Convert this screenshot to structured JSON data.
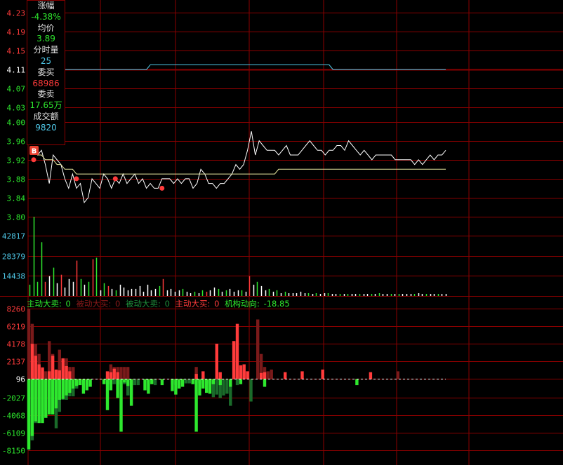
{
  "info_panel": {
    "change_pct_label": "涨幅",
    "change_pct_value": "-4.38%",
    "avg_price_label": "均价",
    "avg_price_value": "3.89",
    "volume_label": "分时量",
    "volume_value": "25",
    "bid_label": "委买",
    "bid_value": "68986",
    "ask_label": "委卖",
    "ask_value": "17.65万",
    "turnover_label": "成交额",
    "turnover_value": "9820"
  },
  "flow_bar": {
    "items": [
      {
        "label": "主动大卖:",
        "value": "0",
        "color": "#2ee82e"
      },
      {
        "label": "被动大买:",
        "value": "0",
        "color": "#8b1a1a"
      },
      {
        "label": "被动大卖:",
        "value": "0",
        "color": "#1e8c3a"
      },
      {
        "label": "主动大买:",
        "value": "0",
        "color": "#ff3b3b"
      }
    ],
    "institution_label": "机构动向:",
    "institution_value": "-18.85"
  },
  "colors": {
    "background": "#000000",
    "grid": "#8b0000",
    "up": "#ff3b3b",
    "down": "#2ee82e",
    "dark_up": "#7a1a1a",
    "dark_down": "#1a6b2a",
    "neutral": "#ffffff",
    "avg_line": "#e8e8a0",
    "index_line": "#4fc8e8"
  },
  "chart_data": [
    {
      "type": "line",
      "name": "price",
      "yticks": [
        "4.23",
        "4.19",
        "4.15",
        "4.11",
        "4.07",
        "4.03",
        "4.00",
        "3.96",
        "3.92",
        "3.88",
        "3.84",
        "3.80"
      ],
      "tick_values": [
        4.23,
        4.19,
        4.15,
        4.11,
        4.07,
        4.03,
        4.0,
        3.96,
        3.92,
        3.88,
        3.84,
        3.8
      ],
      "prev_close": 4.11,
      "ylim": [
        3.8,
        4.23
      ],
      "series": [
        {
          "key": "price",
          "values": [
            3.94,
            3.93,
            3.94,
            3.91,
            3.87,
            3.93,
            3.92,
            3.91,
            3.88,
            3.86,
            3.89,
            3.86,
            3.87,
            3.83,
            3.84,
            3.88,
            3.87,
            3.86,
            3.89,
            3.88,
            3.86,
            3.88,
            3.87,
            3.89,
            3.87,
            3.88,
            3.89,
            3.87,
            3.88,
            3.86,
            3.87,
            3.86,
            3.86,
            3.88,
            3.88,
            3.88,
            3.87,
            3.88,
            3.87,
            3.88,
            3.88,
            3.86,
            3.87,
            3.9,
            3.89,
            3.87,
            3.87,
            3.86,
            3.87,
            3.87,
            3.88,
            3.89,
            3.91,
            3.9,
            3.91,
            3.94,
            3.98,
            3.93,
            3.96,
            3.95,
            3.94,
            3.94,
            3.94,
            3.93,
            3.94,
            3.95,
            3.93,
            3.93,
            3.93,
            3.94,
            3.95,
            3.96,
            3.95,
            3.94,
            3.94,
            3.93,
            3.94,
            3.94,
            3.95,
            3.95,
            3.94,
            3.96,
            3.95,
            3.94,
            3.93,
            3.94,
            3.93,
            3.92,
            3.93,
            3.93,
            3.93,
            3.93,
            3.93,
            3.92,
            3.92,
            3.92,
            3.92,
            3.92,
            3.91,
            3.92,
            3.91,
            3.92,
            3.93,
            3.92,
            3.93,
            3.93,
            3.94
          ]
        },
        {
          "key": "avg",
          "values": [
            3.94,
            3.93,
            3.93,
            3.92,
            3.92,
            3.92,
            3.91,
            3.91,
            3.9,
            3.9,
            3.9,
            3.89,
            3.89,
            3.89,
            3.89,
            3.89,
            3.89,
            3.89,
            3.89,
            3.89,
            3.89,
            3.89,
            3.89,
            3.89,
            3.89,
            3.89,
            3.89,
            3.89,
            3.89,
            3.89,
            3.89,
            3.89,
            3.89,
            3.89,
            3.89,
            3.89,
            3.89,
            3.89,
            3.89,
            3.89,
            3.89,
            3.89,
            3.89,
            3.89,
            3.89,
            3.89,
            3.89,
            3.89,
            3.89,
            3.89,
            3.89,
            3.89,
            3.89,
            3.89,
            3.89,
            3.89,
            3.89,
            3.89,
            3.89,
            3.89,
            3.89,
            3.89,
            3.89,
            3.9,
            3.9,
            3.9,
            3.9,
            3.9,
            3.9,
            3.9,
            3.9,
            3.9,
            3.9,
            3.9,
            3.9,
            3.9,
            3.9,
            3.9,
            3.9,
            3.9,
            3.9,
            3.9,
            3.9,
            3.9,
            3.9,
            3.9,
            3.9,
            3.9,
            3.9,
            3.9,
            3.9,
            3.9,
            3.9,
            3.9,
            3.9,
            3.9,
            3.9,
            3.9,
            3.9,
            3.9,
            3.9,
            3.9,
            3.9,
            3.9,
            3.9,
            3.9,
            3.9
          ]
        },
        {
          "key": "index",
          "values": [
            4.11,
            4.11,
            4.11,
            4.11,
            4.11,
            4.11,
            4.11,
            4.11,
            4.11,
            4.11,
            4.11,
            4.11,
            4.11,
            4.11,
            4.11,
            4.11,
            4.11,
            4.11,
            4.11,
            4.11,
            4.11,
            4.11,
            4.11,
            4.11,
            4.11,
            4.11,
            4.11,
            4.11,
            4.11,
            4.11,
            4.12,
            4.12,
            4.12,
            4.12,
            4.12,
            4.12,
            4.12,
            4.12,
            4.12,
            4.12,
            4.12,
            4.12,
            4.12,
            4.12,
            4.12,
            4.12,
            4.12,
            4.12,
            4.12,
            4.12,
            4.12,
            4.12,
            4.12,
            4.12,
            4.12,
            4.12,
            4.12,
            4.12,
            4.12,
            4.12,
            4.12,
            4.12,
            4.12,
            4.12,
            4.12,
            4.12,
            4.12,
            4.12,
            4.12,
            4.12,
            4.12,
            4.12,
            4.12,
            4.12,
            4.12,
            4.12,
            4.12,
            4.11,
            4.11,
            4.11,
            4.11,
            4.11,
            4.11,
            4.11,
            4.11,
            4.11,
            4.11,
            4.11,
            4.11,
            4.11,
            4.11,
            4.11,
            4.11,
            4.11,
            4.11,
            4.11,
            4.11,
            4.11,
            4.11,
            4.11,
            4.11,
            4.11,
            4.11,
            4.11,
            4.11,
            4.11,
            4.11
          ]
        }
      ],
      "markers": [
        {
          "label": "B",
          "index": 0
        },
        {
          "index": 0,
          "value": 3.92
        },
        {
          "index": 11,
          "value": 3.88
        },
        {
          "index": 21,
          "value": 3.88
        },
        {
          "index": 33,
          "value": 3.86
        }
      ]
    },
    {
      "type": "bar",
      "name": "volume",
      "yticks": [
        "42817",
        "28379",
        "14438"
      ],
      "tick_values": [
        42817,
        28379,
        14438
      ],
      "ylim": [
        0,
        56000
      ],
      "values": [
        8000,
        56000,
        10000,
        38000,
        10000,
        14000,
        20000,
        9000,
        15000,
        6000,
        12000,
        10000,
        25000,
        12000,
        8000,
        10000,
        26000,
        27000,
        4000,
        9000,
        7000,
        5000,
        4000,
        8000,
        6000,
        4000,
        5000,
        5000,
        7000,
        3000,
        8000,
        4000,
        5000,
        7000,
        12000,
        4000,
        5000,
        3000,
        4000,
        5000,
        3000,
        2000,
        3000,
        2000,
        4000,
        3000,
        4000,
        6000,
        5000,
        3000,
        4000,
        5000,
        3000,
        4000,
        4000,
        3000,
        14000,
        8000,
        10000,
        7000,
        4000,
        5000,
        3000,
        4000,
        2000,
        3000,
        2000,
        2000,
        2000,
        3000,
        2000,
        2000,
        1500,
        2000,
        1500,
        2000,
        2000,
        1500,
        1500,
        1500,
        1500,
        1500,
        1500,
        1500,
        1500,
        1500,
        1500,
        1500,
        1500,
        2000,
        1500,
        1500,
        1500,
        1500,
        1500,
        1500,
        1500,
        1500,
        1500,
        2000,
        1500,
        1500,
        1500,
        1500,
        1500,
        1500,
        1500
      ],
      "colors": [
        "g",
        "g",
        "g",
        "g",
        "r",
        "w",
        "g",
        "w",
        "r",
        "w",
        "w",
        "w",
        "r",
        "g",
        "w",
        "g",
        "r",
        "g",
        "w",
        "g",
        "r",
        "w",
        "g",
        "w",
        "w",
        "w",
        "w",
        "w",
        "w",
        "w",
        "w",
        "w",
        "w",
        "g",
        "r",
        "w",
        "w",
        "w",
        "w",
        "g",
        "w",
        "w",
        "g",
        "w",
        "g",
        "r",
        "w",
        "w",
        "g",
        "w",
        "g",
        "w",
        "w",
        "w",
        "g",
        "w",
        "r",
        "w",
        "g",
        "w",
        "w",
        "g",
        "w",
        "g",
        "w",
        "g",
        "w",
        "w",
        "w",
        "w",
        "w",
        "g",
        "w",
        "g",
        "w",
        "w",
        "g",
        "w",
        "w",
        "g",
        "w",
        "g",
        "w",
        "w",
        "g",
        "w",
        "w",
        "g",
        "w",
        "g",
        "w",
        "w",
        "g",
        "w",
        "g",
        "w",
        "w",
        "w",
        "g",
        "w",
        "w",
        "g",
        "w",
        "w",
        "g",
        "w",
        "w"
      ]
    },
    {
      "type": "bar",
      "name": "fund_flow",
      "yticks": [
        "8260",
        "6219",
        "4178",
        "2137",
        "96",
        "-2027",
        "-4068",
        "-6109",
        "-8150"
      ],
      "tick_values": [
        8260,
        6219,
        4178,
        2137,
        96,
        -2027,
        -4068,
        -6109,
        -8150
      ],
      "ylim": [
        -8150,
        8260
      ],
      "layers": [
        {
          "key": "dark_up",
          "values": [
            8260,
            6500,
            4178,
            3000,
            1500,
            1000,
            4500,
            3000,
            1000,
            3500,
            2500,
            2500,
            1500,
            1500,
            0,
            0,
            0,
            0,
            0,
            0,
            0,
            0,
            0,
            0,
            1800,
            1500,
            1500,
            1500,
            1500,
            1500,
            0,
            0,
            0,
            0,
            0,
            0,
            0,
            0,
            0,
            0,
            0,
            0,
            0,
            0,
            0,
            0,
            0,
            0,
            0,
            1500,
            0,
            0,
            0,
            0,
            0,
            0,
            0,
            0,
            0,
            0,
            4500,
            1200,
            1000,
            1000,
            1000,
            0,
            0,
            7000,
            3000,
            1500,
            1000,
            1200,
            0,
            0,
            0,
            0,
            0,
            0,
            0,
            0,
            0,
            0,
            0,
            0,
            0,
            0,
            0,
            0,
            0,
            0,
            0,
            0,
            0,
            0,
            0,
            0,
            0,
            0,
            0,
            0,
            0,
            0,
            0,
            0,
            0,
            0,
            0,
            0,
            1000,
            0,
            0,
            0,
            0,
            0,
            0,
            0,
            0,
            0,
            0,
            0,
            0,
            0,
            0
          ]
        },
        {
          "key": "up",
          "values": [
            0,
            4178,
            2800,
            1800,
            1400,
            0,
            1000,
            2800,
            1200,
            1100,
            2500,
            1600,
            1000,
            0,
            0,
            0,
            0,
            0,
            0,
            0,
            0,
            0,
            0,
            1000,
            900,
            1300,
            900,
            0,
            0,
            0,
            0,
            0,
            0,
            0,
            0,
            0,
            0,
            0,
            0,
            0,
            0,
            0,
            0,
            0,
            0,
            0,
            0,
            0,
            0,
            700,
            0,
            1000,
            0,
            0,
            0,
            4200,
            900,
            0,
            0,
            0,
            4500,
            6500,
            1700,
            1800,
            1000,
            0,
            0,
            0,
            800,
            900,
            0,
            0,
            0,
            0,
            0,
            900,
            0,
            0,
            0,
            0,
            1000,
            0,
            0,
            0,
            0,
            0,
            1200,
            0,
            0,
            0,
            0,
            0,
            0,
            0,
            0,
            0,
            0,
            0,
            0,
            0,
            900,
            0,
            0,
            0,
            0,
            0,
            0,
            0,
            0,
            0,
            0,
            0,
            0,
            0,
            0,
            0
          ]
        },
        {
          "key": "dark_down",
          "values": [
            -8150,
            -7000,
            -5000,
            -4000,
            -4500,
            -3500,
            -3500,
            -4000,
            -5600,
            -3700,
            -2300,
            -2300,
            -1900,
            -1900,
            -1000,
            0,
            0,
            0,
            0,
            0,
            0,
            0,
            0,
            -500,
            -500,
            -500,
            -500,
            -500,
            -500,
            -1800,
            -1800,
            -600,
            -600,
            0,
            0,
            0,
            0,
            -600,
            0,
            0,
            0,
            0,
            -500,
            -600,
            0,
            0,
            -400,
            -400,
            0,
            0,
            -400,
            -400,
            -600,
            -400,
            -2000,
            -1700,
            -2100,
            -1800,
            -1600,
            -3000,
            0,
            -600,
            0,
            0,
            0,
            -2500,
            0,
            0,
            0,
            0,
            0,
            0,
            0,
            0,
            0,
            0,
            0,
            0,
            0,
            0,
            0,
            0,
            0,
            0,
            0,
            0,
            0,
            0,
            0,
            0,
            0,
            0,
            0,
            0,
            0,
            0,
            0,
            0,
            0,
            0,
            0,
            0,
            0,
            0,
            0,
            0,
            0,
            0,
            0,
            0,
            0,
            0,
            0,
            0,
            0,
            0,
            0,
            0,
            0,
            0,
            0
          ]
        },
        {
          "key": "down",
          "values": [
            -8000,
            -6500,
            -4800,
            -5000,
            -5000,
            -4400,
            -4000,
            -4000,
            -3300,
            -2300,
            -2200,
            -1800,
            -1500,
            -1000,
            -700,
            -600,
            -1600,
            -1200,
            -800,
            0,
            0,
            0,
            -500,
            -3500,
            -1200,
            0,
            -2100,
            -6000,
            -300,
            -700,
            -3000,
            0,
            0,
            0,
            -1200,
            -1600,
            -500,
            0,
            0,
            -600,
            0,
            0,
            -1300,
            -1700,
            -1000,
            -800,
            0,
            0,
            -500,
            -6000,
            -1800,
            -1000,
            -1500,
            -1600,
            -500,
            0,
            -600,
            0,
            0,
            -800,
            0,
            0,
            -500,
            0,
            0,
            0,
            0,
            0,
            0,
            -800,
            0,
            0,
            0,
            0,
            0,
            0,
            0,
            0,
            0,
            0,
            0,
            0,
            0,
            0,
            0,
            0,
            0,
            0,
            0,
            0,
            0,
            0,
            0,
            0,
            0,
            0,
            -600,
            0,
            0,
            0,
            0,
            0,
            0,
            0,
            0,
            0,
            0,
            0,
            0,
            0,
            0,
            0,
            0,
            0,
            0,
            0,
            0,
            0,
            0,
            0
          ]
        }
      ]
    }
  ]
}
